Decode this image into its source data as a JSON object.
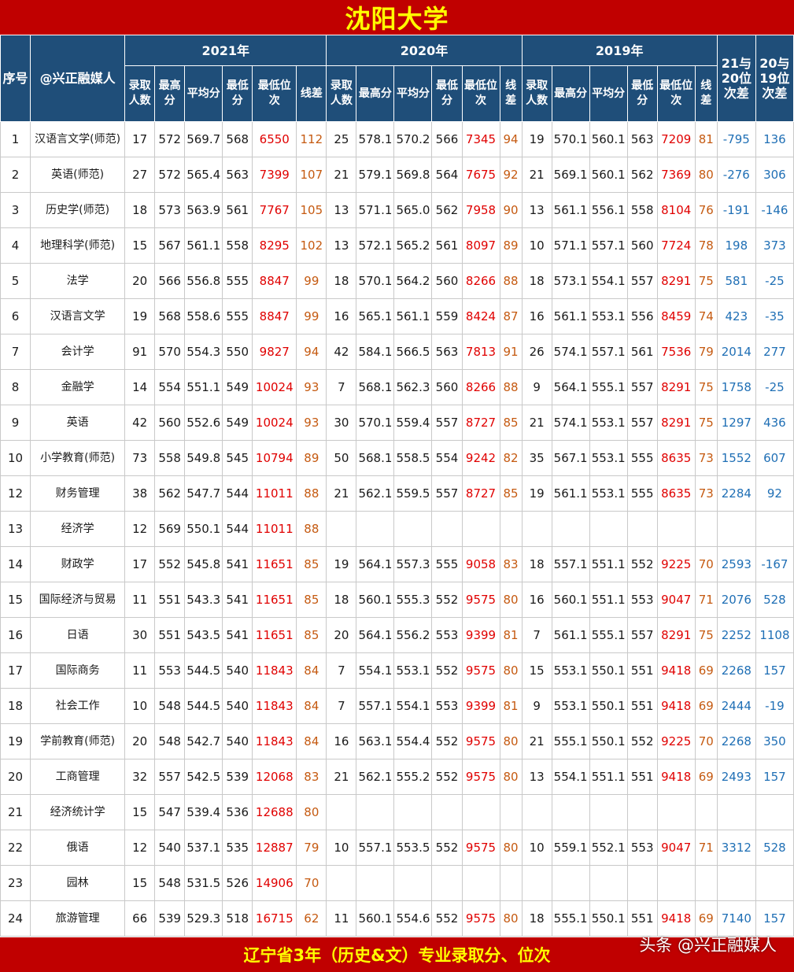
{
  "title": "沈阳大学",
  "footer": "辽宁省3年（历史&文）专业录取分、位次",
  "watermark": "头条 @兴正融媒人",
  "header": {
    "seq": "序号",
    "major": "@兴正融媒人",
    "years": [
      "2021年",
      "2020年",
      "2019年"
    ],
    "diff21_20": "21与20位次差",
    "diff20_19": "20与19位次差",
    "sub": [
      "录取人数",
      "最高分",
      "平均分",
      "最低分",
      "最低位次",
      "线差"
    ]
  },
  "rows": [
    [
      "1",
      "汉语言文学(师范)",
      "17",
      "572",
      "569.7",
      "568",
      "6550",
      "112",
      "25",
      "578.1",
      "570.2",
      "566",
      "7345",
      "94",
      "19",
      "570.1",
      "560.1",
      "563",
      "7209",
      "81",
      "-795",
      "136"
    ],
    [
      "2",
      "英语(师范)",
      "27",
      "572",
      "565.4",
      "563",
      "7399",
      "107",
      "21",
      "579.1",
      "569.8",
      "564",
      "7675",
      "92",
      "21",
      "569.1",
      "560.1",
      "562",
      "7369",
      "80",
      "-276",
      "306"
    ],
    [
      "3",
      "历史学(师范)",
      "18",
      "573",
      "563.9",
      "561",
      "7767",
      "105",
      "13",
      "571.1",
      "565.0",
      "562",
      "7958",
      "90",
      "13",
      "561.1",
      "556.1",
      "558",
      "8104",
      "76",
      "-191",
      "-146"
    ],
    [
      "4",
      "地理科学(师范)",
      "15",
      "567",
      "561.1",
      "558",
      "8295",
      "102",
      "13",
      "572.1",
      "565.2",
      "561",
      "8097",
      "89",
      "10",
      "571.1",
      "557.1",
      "560",
      "7724",
      "78",
      "198",
      "373"
    ],
    [
      "5",
      "法学",
      "20",
      "566",
      "556.8",
      "555",
      "8847",
      "99",
      "18",
      "570.1",
      "564.2",
      "560",
      "8266",
      "88",
      "18",
      "573.1",
      "554.1",
      "557",
      "8291",
      "75",
      "581",
      "-25"
    ],
    [
      "6",
      "汉语言文学",
      "19",
      "568",
      "558.6",
      "555",
      "8847",
      "99",
      "16",
      "565.1",
      "561.1",
      "559",
      "8424",
      "87",
      "16",
      "561.1",
      "553.1",
      "556",
      "8459",
      "74",
      "423",
      "-35"
    ],
    [
      "7",
      "会计学",
      "91",
      "570",
      "554.3",
      "550",
      "9827",
      "94",
      "42",
      "584.1",
      "566.5",
      "563",
      "7813",
      "91",
      "26",
      "574.1",
      "557.1",
      "561",
      "7536",
      "79",
      "2014",
      "277"
    ],
    [
      "8",
      "金融学",
      "14",
      "554",
      "551.1",
      "549",
      "10024",
      "93",
      "7",
      "568.1",
      "562.3",
      "560",
      "8266",
      "88",
      "9",
      "564.1",
      "555.1",
      "557",
      "8291",
      "75",
      "1758",
      "-25"
    ],
    [
      "9",
      "英语",
      "42",
      "560",
      "552.6",
      "549",
      "10024",
      "93",
      "30",
      "570.1",
      "559.4",
      "557",
      "8727",
      "85",
      "21",
      "574.1",
      "553.1",
      "557",
      "8291",
      "75",
      "1297",
      "436"
    ],
    [
      "10",
      "小学教育(师范)",
      "73",
      "558",
      "549.8",
      "545",
      "10794",
      "89",
      "50",
      "568.1",
      "558.5",
      "554",
      "9242",
      "82",
      "35",
      "567.1",
      "553.1",
      "555",
      "8635",
      "73",
      "1552",
      "607"
    ],
    [
      "12",
      "财务管理",
      "38",
      "562",
      "547.7",
      "544",
      "11011",
      "88",
      "21",
      "562.1",
      "559.5",
      "557",
      "8727",
      "85",
      "19",
      "561.1",
      "553.1",
      "555",
      "8635",
      "73",
      "2284",
      "92"
    ],
    [
      "13",
      "经济学",
      "12",
      "569",
      "550.1",
      "544",
      "11011",
      "88",
      "",
      "",
      "",
      "",
      "",
      "",
      "",
      "",
      "",
      "",
      "",
      "",
      "",
      ""
    ],
    [
      "14",
      "财政学",
      "17",
      "552",
      "545.8",
      "541",
      "11651",
      "85",
      "19",
      "564.1",
      "557.3",
      "555",
      "9058",
      "83",
      "18",
      "557.1",
      "551.1",
      "552",
      "9225",
      "70",
      "2593",
      "-167"
    ],
    [
      "15",
      "国际经济与贸易",
      "11",
      "551",
      "543.3",
      "541",
      "11651",
      "85",
      "18",
      "560.1",
      "555.3",
      "552",
      "9575",
      "80",
      "16",
      "560.1",
      "551.1",
      "553",
      "9047",
      "71",
      "2076",
      "528"
    ],
    [
      "16",
      "日语",
      "30",
      "551",
      "543.5",
      "541",
      "11651",
      "85",
      "20",
      "564.1",
      "556.2",
      "553",
      "9399",
      "81",
      "7",
      "561.1",
      "555.1",
      "557",
      "8291",
      "75",
      "2252",
      "1108"
    ],
    [
      "17",
      "国际商务",
      "11",
      "553",
      "544.5",
      "540",
      "11843",
      "84",
      "7",
      "554.1",
      "553.1",
      "552",
      "9575",
      "80",
      "15",
      "553.1",
      "550.1",
      "551",
      "9418",
      "69",
      "2268",
      "157"
    ],
    [
      "18",
      "社会工作",
      "10",
      "548",
      "544.5",
      "540",
      "11843",
      "84",
      "7",
      "557.1",
      "554.1",
      "553",
      "9399",
      "81",
      "9",
      "553.1",
      "550.1",
      "551",
      "9418",
      "69",
      "2444",
      "-19"
    ],
    [
      "19",
      "学前教育(师范)",
      "20",
      "548",
      "542.7",
      "540",
      "11843",
      "84",
      "16",
      "563.1",
      "554.4",
      "552",
      "9575",
      "80",
      "21",
      "555.1",
      "550.1",
      "552",
      "9225",
      "70",
      "2268",
      "350"
    ],
    [
      "20",
      "工商管理",
      "32",
      "557",
      "542.5",
      "539",
      "12068",
      "83",
      "21",
      "562.1",
      "555.2",
      "552",
      "9575",
      "80",
      "13",
      "554.1",
      "551.1",
      "551",
      "9418",
      "69",
      "2493",
      "157"
    ],
    [
      "21",
      "经济统计学",
      "15",
      "547",
      "539.4",
      "536",
      "12688",
      "80",
      "",
      "",
      "",
      "",
      "",
      "",
      "",
      "",
      "",
      "",
      "",
      "",
      "",
      ""
    ],
    [
      "22",
      "俄语",
      "12",
      "540",
      "537.1",
      "535",
      "12887",
      "79",
      "10",
      "557.1",
      "553.5",
      "552",
      "9575",
      "80",
      "10",
      "559.1",
      "552.1",
      "553",
      "9047",
      "71",
      "3312",
      "528"
    ],
    [
      "23",
      "园林",
      "15",
      "548",
      "531.5",
      "526",
      "14906",
      "70",
      "",
      "",
      "",
      "",
      "",
      "",
      "",
      "",
      "",
      "",
      "",
      "",
      "",
      ""
    ],
    [
      "24",
      "旅游管理",
      "66",
      "539",
      "529.3",
      "518",
      "16715",
      "62",
      "11",
      "560.1",
      "554.6",
      "552",
      "9575",
      "80",
      "18",
      "555.1",
      "550.1",
      "551",
      "9418",
      "69",
      "7140",
      "157"
    ]
  ],
  "colors": {
    "title_bg": "#c00000",
    "title_fg": "#ffff00",
    "header_bg": "#1f4e79",
    "rank_red": "#e00000",
    "gap_orange": "#c55a11",
    "diff_blue": "#1f6fb5"
  }
}
